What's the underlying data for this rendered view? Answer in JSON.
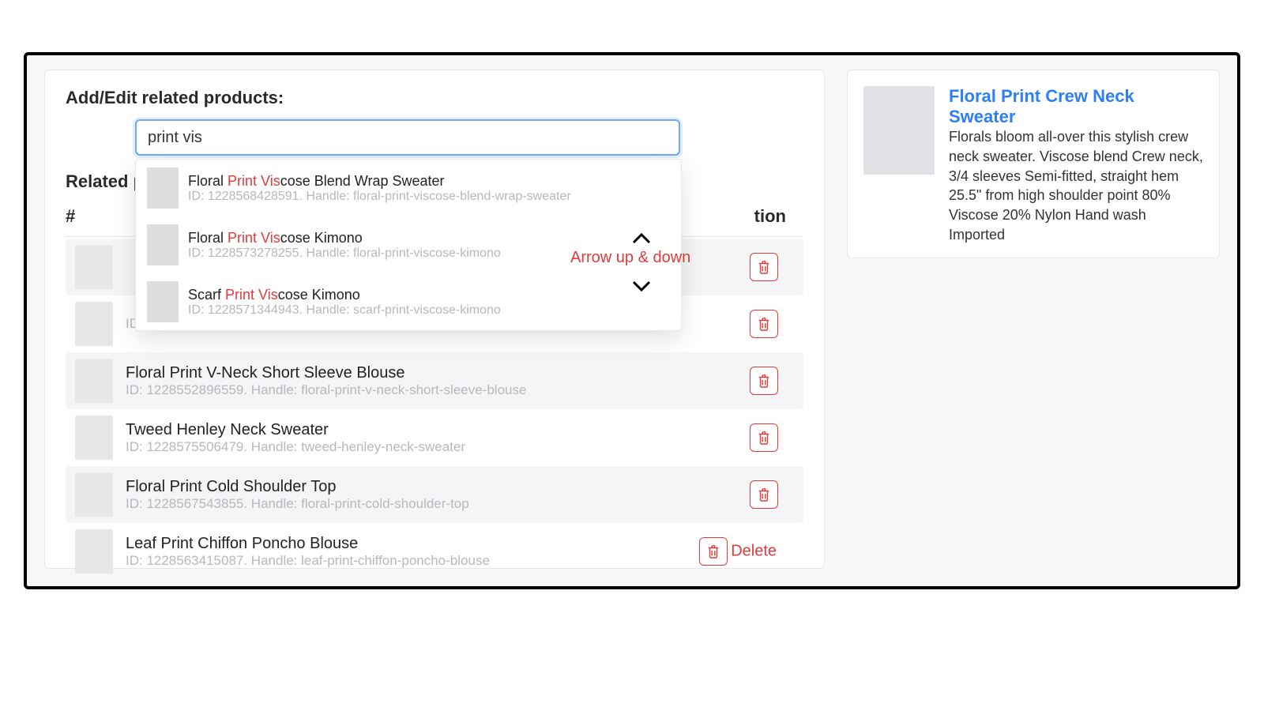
{
  "left": {
    "title": "Add/Edit related products:",
    "search_value": "print vis",
    "section_title": "Related p",
    "col_hash": "#",
    "col_action_tail": "tion",
    "rows": [
      {
        "name": "",
        "id": "",
        "handle": ""
      },
      {
        "name": "",
        "id_line": "ID: 1228569215023. Handle: tripe-boat-neck-sweater"
      },
      {
        "name": "Floral Print V-Neck Short Sleeve Blouse",
        "id_line": "ID: 1228552896559. Handle: floral-print-v-neck-short-sleeve-blouse"
      },
      {
        "name": "Tweed Henley Neck Sweater",
        "id_line": "ID: 1228575506479. Handle: tweed-henley-neck-sweater"
      },
      {
        "name": "Floral Print Cold Shoulder Top",
        "id_line": "ID: 1228567543855. Handle: floral-print-cold-shoulder-top"
      },
      {
        "name": "Leaf Print Chiffon Poncho Blouse",
        "id_line": "ID: 1228563415087. Handle: leaf-print-chiffon-poncho-blouse"
      }
    ],
    "delete_label": "Delete"
  },
  "autocomplete": {
    "items": [
      {
        "pre": "Floral ",
        "match": "Print Vis",
        "post": "cose Blend Wrap Sweater",
        "sub": "ID: 1228568428591. Handle: floral-print-viscose-blend-wrap-sweater"
      },
      {
        "pre": "Floral ",
        "match": "Print Vis",
        "post": "cose Kimono",
        "sub": "ID: 1228573278255. Handle: floral-print-viscose-kimono"
      },
      {
        "pre": "Scarf ",
        "match": "Print Vis",
        "post": "cose Kimono",
        "sub": "ID: 1228571344943. Handle: scarf-print-viscose-kimono"
      }
    ]
  },
  "annotation": "Arrow up & down",
  "right": {
    "title": "Floral Print Crew Neck Sweater",
    "desc": "Florals bloom all-over this stylish crew neck sweater.  Viscose blend Crew neck, 3/4 sleeves Semi-fitted, straight hem 25.5\" from high shoulder point 80% Viscose 20% Nylon Hand wash Imported"
  }
}
